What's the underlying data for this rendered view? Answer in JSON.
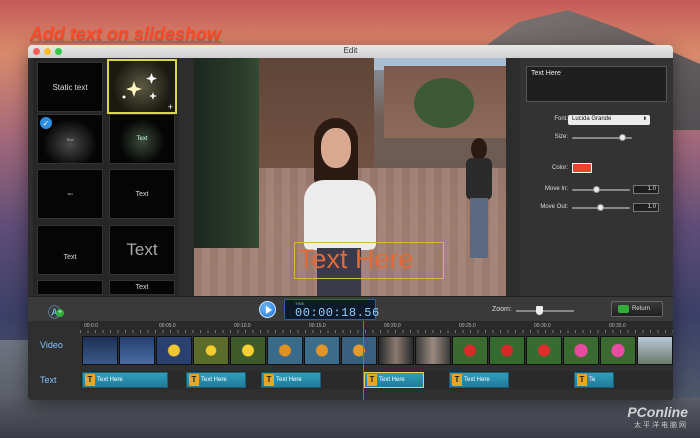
{
  "headline": "Add text on slideshow",
  "window": {
    "title": "Edit"
  },
  "presets": {
    "static_text": "Static text",
    "items": [
      {
        "label": "Text"
      },
      {
        "label": "Text"
      },
      {
        "label": "Text"
      },
      {
        "label": "Text"
      },
      {
        "label": "Text"
      },
      {
        "label": "Text"
      },
      {
        "label": "Text"
      }
    ]
  },
  "preview": {
    "overlay_text": "Text Here"
  },
  "properties": {
    "text_value": "Text Here",
    "font_label": "Font:",
    "font_value": "Lucida Grande",
    "size_label": "Size:",
    "color_label": "Color:",
    "move_in_label": "Move In:",
    "move_in_value": "1.0",
    "move_out_label": "Move Out:",
    "move_out_value": "1.0",
    "color_value": "#e8452a"
  },
  "controls": {
    "time_label": "TIME",
    "time_value": "00:00:18.56",
    "zoom_label": "Zoom:",
    "return_label": "Return"
  },
  "timeline": {
    "ticks": [
      "00:0.0",
      "00:05.0",
      "00:10.0",
      "00:15.0",
      "00:20.0",
      "00:25.0",
      "00:30.0",
      "00:35.0"
    ],
    "video_label": "Video",
    "text_label": "Text",
    "clips": [
      {
        "label": "Text Here"
      },
      {
        "label": "Text Here"
      },
      {
        "label": "Text Here"
      },
      {
        "label": "Text Here"
      },
      {
        "label": "Text Here"
      },
      {
        "label": "Te"
      }
    ]
  },
  "watermark": {
    "line1": "PConline",
    "line2": "太平洋电脑网"
  }
}
